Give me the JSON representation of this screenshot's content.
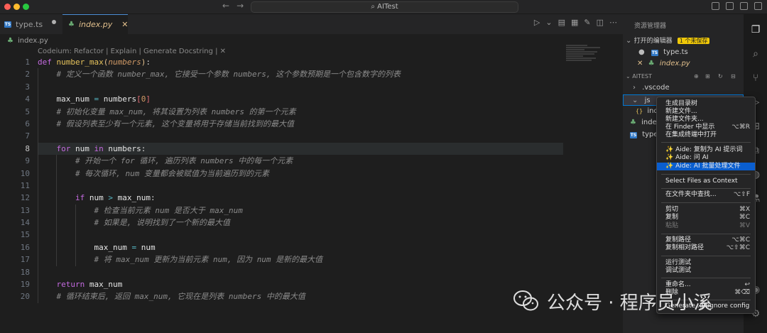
{
  "window": {
    "title": "AITest",
    "traffic_colors": [
      "#fe5f57",
      "#febc2e",
      "#28c840"
    ]
  },
  "tabs": [
    {
      "label": "type.ts",
      "badge": "TS"
    },
    {
      "label": "index.py",
      "close": "✕"
    }
  ],
  "breadcrumb": "index.py",
  "codelens": "Codeium: Refactor | Explain | Generate Docstring | ✕",
  "editor": {
    "active_line": 8,
    "line_numbers": [
      "1",
      "2",
      "3",
      "4",
      "5",
      "6",
      "7",
      "8",
      "9",
      "10",
      "11",
      "12",
      "13",
      "14",
      "15",
      "16",
      "17",
      "18",
      "19",
      "20"
    ],
    "code": {
      "l1": {
        "def": "def",
        "name": "number_max",
        "open": "(",
        "param": "numbers",
        "close": ")",
        "colon": ":"
      },
      "l2": "# 定义一个函数 number_max, 它接受一个参数 numbers, 这个参数预期是一个包含数字的列表",
      "l4": {
        "var": "max_num",
        "eq": "=",
        "src": "numbers",
        "ob": "[",
        "idx": "0",
        "cb": "]"
      },
      "l5": "# 初始化变量 max_num, 将其设置为列表 numbers 的第一个元素",
      "l6": "# 假设列表至少有一个元素, 这个变量将用于存储当前找到的最大值",
      "l8": {
        "for": "for",
        "var": "num",
        "in": "in",
        "src": "numbers",
        "colon": ":"
      },
      "l9": "# 开始一个 for 循环, 遍历列表 numbers 中的每一个元素",
      "l10": "# 每次循环, num 变量都会被赋值为当前遍历到的元素",
      "l12": {
        "if": "if",
        "a": "num",
        "gt": ">",
        "b": "max_num",
        "colon": ":"
      },
      "l13": "# 检查当前元素 num 是否大于 max_num",
      "l14": "# 如果是, 说明找到了一个新的最大值",
      "l16": {
        "var": "max_num",
        "eq": "=",
        "val": "num"
      },
      "l17": "# 将 max_num 更新为当前元素 num, 因为 num 是新的最大值",
      "l19": {
        "ret": "return",
        "val": "max_num"
      },
      "l20": "# 循环结束后, 返回 max_num, 它现在是列表 numbers 中的最大值"
    }
  },
  "explorer": {
    "title": "资源管理器",
    "open_editors": "打开的编辑器",
    "unsaved_badge": "1 个未保存",
    "open_files": [
      "type.ts",
      "index.py"
    ],
    "project": "AITEST",
    "tree": [
      ".vscode",
      "js",
      "ind",
      "inde",
      "type"
    ]
  },
  "context_menu": {
    "items": [
      {
        "label": "生成目录树",
        "shortcut": ""
      },
      {
        "label": "新建文件...",
        "shortcut": ""
      },
      {
        "label": "新建文件夹...",
        "shortcut": ""
      },
      {
        "label": "在 Finder 中显示",
        "shortcut": "⌥⌘R"
      },
      {
        "label": "在集成终端中打开",
        "shortcut": ""
      },
      {
        "label": "✨ Aide: 复制为 AI 提示词",
        "shortcut": ""
      },
      {
        "label": "✨ Aide: 问 AI",
        "shortcut": ""
      },
      {
        "label": "✨ Aide: AI 批量处理文件",
        "shortcut": ""
      },
      {
        "label": "Select Files as Context",
        "shortcut": ""
      },
      {
        "label": "在文件夹中查找...",
        "shortcut": "⌥⇧F"
      },
      {
        "label": "剪切",
        "shortcut": "⌘X"
      },
      {
        "label": "复制",
        "shortcut": "⌘C"
      },
      {
        "label": "粘贴",
        "shortcut": "⌘V"
      },
      {
        "label": "复制路径",
        "shortcut": "⌥⌘C"
      },
      {
        "label": "复制相对路径",
        "shortcut": "⌥⇧⌘C"
      },
      {
        "label": "运行测试",
        "shortcut": ""
      },
      {
        "label": "调试测试",
        "shortcut": ""
      },
      {
        "label": "重命名...",
        "shortcut": "↩"
      },
      {
        "label": "删除",
        "shortcut": "⌘⌫"
      },
      {
        "label": "Generate .gitignore config",
        "shortcut": ""
      }
    ],
    "highlight_color": "#0a5ecf"
  },
  "watermark": {
    "text": "公众号 · 程序员小溪"
  }
}
